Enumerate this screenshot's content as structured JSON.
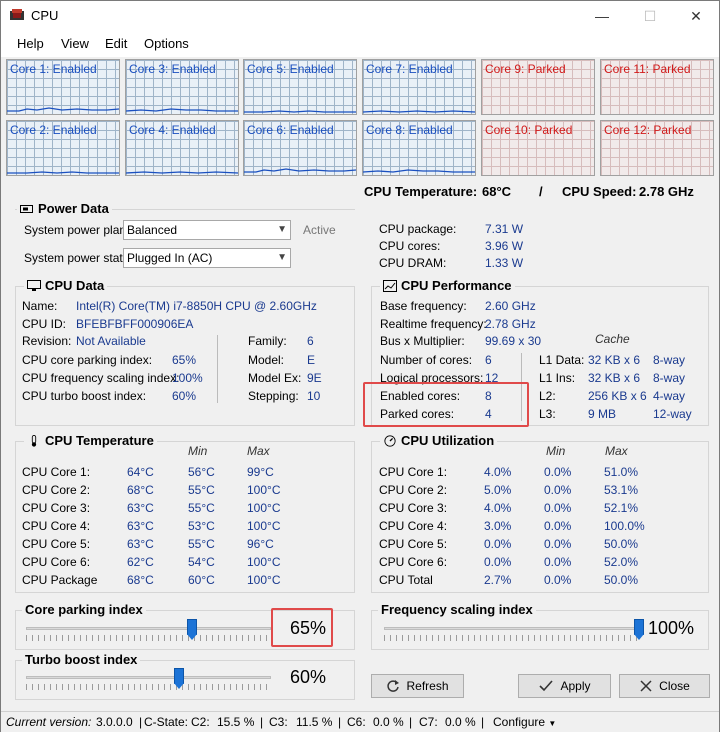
{
  "window": {
    "title": "CPU",
    "minimize_glyph": "—",
    "maximize_glyph": "☐",
    "close_glyph": "✕"
  },
  "menu": [
    "Help",
    "View",
    "Edit",
    "Options"
  ],
  "cores": [
    {
      "label": "Core 1: Enabled",
      "state": "enabled"
    },
    {
      "label": "Core 3: Enabled",
      "state": "enabled"
    },
    {
      "label": "Core 5: Enabled",
      "state": "enabled"
    },
    {
      "label": "Core 7: Enabled",
      "state": "enabled"
    },
    {
      "label": "Core 9: Parked",
      "state": "parked"
    },
    {
      "label": "Core 11: Parked",
      "state": "parked"
    },
    {
      "label": "Core 2: Enabled",
      "state": "enabled"
    },
    {
      "label": "Core 4: Enabled",
      "state": "enabled"
    },
    {
      "label": "Core 6: Enabled",
      "state": "enabled"
    },
    {
      "label": "Core 8: Enabled",
      "state": "enabled"
    },
    {
      "label": "Core 10: Parked",
      "state": "parked"
    },
    {
      "label": "Core 12: Parked",
      "state": "parked"
    }
  ],
  "summary": {
    "temp_label": "CPU Temperature:",
    "temp_value": "68°C",
    "separator": "/",
    "speed_label": "CPU Speed:",
    "speed_value": "2.78 GHz"
  },
  "power": {
    "title": "Power Data",
    "plan_label": "System power plan:",
    "plan_value": "Balanced",
    "plan_status": "Active",
    "state_label": "System power state:",
    "state_value": "Plugged In (AC)",
    "rows": [
      {
        "label": "CPU package:",
        "value": "7.31 W"
      },
      {
        "label": "CPU cores:",
        "value": "3.96 W"
      },
      {
        "label": "CPU DRAM:",
        "value": "1.33 W"
      }
    ]
  },
  "cpu_data": {
    "title": "CPU Data",
    "name_label": "Name:",
    "name_value": "Intel(R) Core(TM) i7-8850H CPU @ 2.60GHz",
    "id_label": "CPU ID:",
    "id_value": "BFEBFBFF000906EA",
    "revision_label": "Revision:",
    "revision_value": "Not Available",
    "left_rows": [
      {
        "label": "CPU core parking index:",
        "value": "65%"
      },
      {
        "label": "CPU frequency scaling index:",
        "value": "100%"
      },
      {
        "label": "CPU turbo boost index:",
        "value": "60%"
      }
    ],
    "right_rows": [
      {
        "label": "Family:",
        "value": "6"
      },
      {
        "label": "Model:",
        "value": "E"
      },
      {
        "label": "Model Ex:",
        "value": "9E"
      },
      {
        "label": "Stepping:",
        "value": "10"
      }
    ]
  },
  "cpu_perf": {
    "title": "CPU Performance",
    "rows": [
      {
        "label": "Base frequency:",
        "value": "2.60 GHz"
      },
      {
        "label": "Realtime frequency:",
        "value": "2.78 GHz"
      },
      {
        "label": "Bus x Multiplier:",
        "value": "99.69 x 30"
      },
      {
        "label": "Number of cores:",
        "value": "6"
      },
      {
        "label": "Logical processors:",
        "value": "12"
      },
      {
        "label": "Enabled cores:",
        "value": "8"
      },
      {
        "label": "Parked cores:",
        "value": "4"
      }
    ],
    "cache_header": "Cache",
    "cache": [
      {
        "label": "L1 Data:",
        "size": "32 KB x 6",
        "way": "8-way"
      },
      {
        "label": "L1 Ins:",
        "size": "32 KB x 6",
        "way": "8-way"
      },
      {
        "label": "L2:",
        "size": "256 KB x 6",
        "way": "4-way"
      },
      {
        "label": "L3:",
        "size": "9 MB",
        "way": "12-way"
      }
    ]
  },
  "cpu_temp": {
    "title": "CPU Temperature",
    "col_min": "Min",
    "col_max": "Max",
    "rows": [
      {
        "label": "CPU Core 1:",
        "cur": "64°C",
        "min": "56°C",
        "max": "99°C"
      },
      {
        "label": "CPU Core 2:",
        "cur": "68°C",
        "min": "55°C",
        "max": "100°C"
      },
      {
        "label": "CPU Core 3:",
        "cur": "63°C",
        "min": "55°C",
        "max": "100°C"
      },
      {
        "label": "CPU Core 4:",
        "cur": "63°C",
        "min": "53°C",
        "max": "100°C"
      },
      {
        "label": "CPU Core 5:",
        "cur": "63°C",
        "min": "55°C",
        "max": "96°C"
      },
      {
        "label": "CPU Core 6:",
        "cur": "62°C",
        "min": "54°C",
        "max": "100°C"
      },
      {
        "label": "CPU Package",
        "cur": "68°C",
        "min": "60°C",
        "max": "100°C"
      }
    ]
  },
  "cpu_util": {
    "title": "CPU Utilization",
    "col_min": "Min",
    "col_max": "Max",
    "rows": [
      {
        "label": "CPU Core 1:",
        "cur": "4.0%",
        "min": "0.0%",
        "max": "51.0%"
      },
      {
        "label": "CPU Core 2:",
        "cur": "5.0%",
        "min": "0.0%",
        "max": "53.1%"
      },
      {
        "label": "CPU Core 3:",
        "cur": "4.0%",
        "min": "0.0%",
        "max": "52.1%"
      },
      {
        "label": "CPU Core 4:",
        "cur": "3.0%",
        "min": "0.0%",
        "max": "100.0%"
      },
      {
        "label": "CPU Core 5:",
        "cur": "0.0%",
        "min": "0.0%",
        "max": "50.0%"
      },
      {
        "label": "CPU Core 6:",
        "cur": "0.0%",
        "min": "0.0%",
        "max": "52.0%"
      },
      {
        "label": "CPU Total",
        "cur": "2.7%",
        "min": "0.0%",
        "max": "50.0%"
      }
    ]
  },
  "sliders": {
    "parking": {
      "title": "Core parking index",
      "value": "65%",
      "fraction": 0.65
    },
    "frequency": {
      "title": "Frequency scaling index",
      "value": "100%",
      "fraction": 1.0
    },
    "turbo": {
      "title": "Turbo boost index",
      "value": "60%",
      "fraction": 0.6
    }
  },
  "buttons": {
    "refresh": "Refresh",
    "apply": "Apply",
    "close": "Close"
  },
  "status": {
    "version_label": "Current version:",
    "version_value": "3.0.0.0",
    "cstate": "C-State:",
    "c2_label": "C2:",
    "c2_value": "15.5 %",
    "c3_label": "C3:",
    "c3_value": "11.5 %",
    "c6_label": "C6:",
    "c6_value": "0.0 %",
    "c7_label": "C7:",
    "c7_value": "0.0 %",
    "configure": "Configure"
  },
  "colors": {
    "enabled_text": "#1a4fbf",
    "parked_text": "#d11a1a",
    "value_text": "#1a3a8f",
    "highlight": "#e04a4a",
    "slider_thumb": "#1c73d6"
  }
}
